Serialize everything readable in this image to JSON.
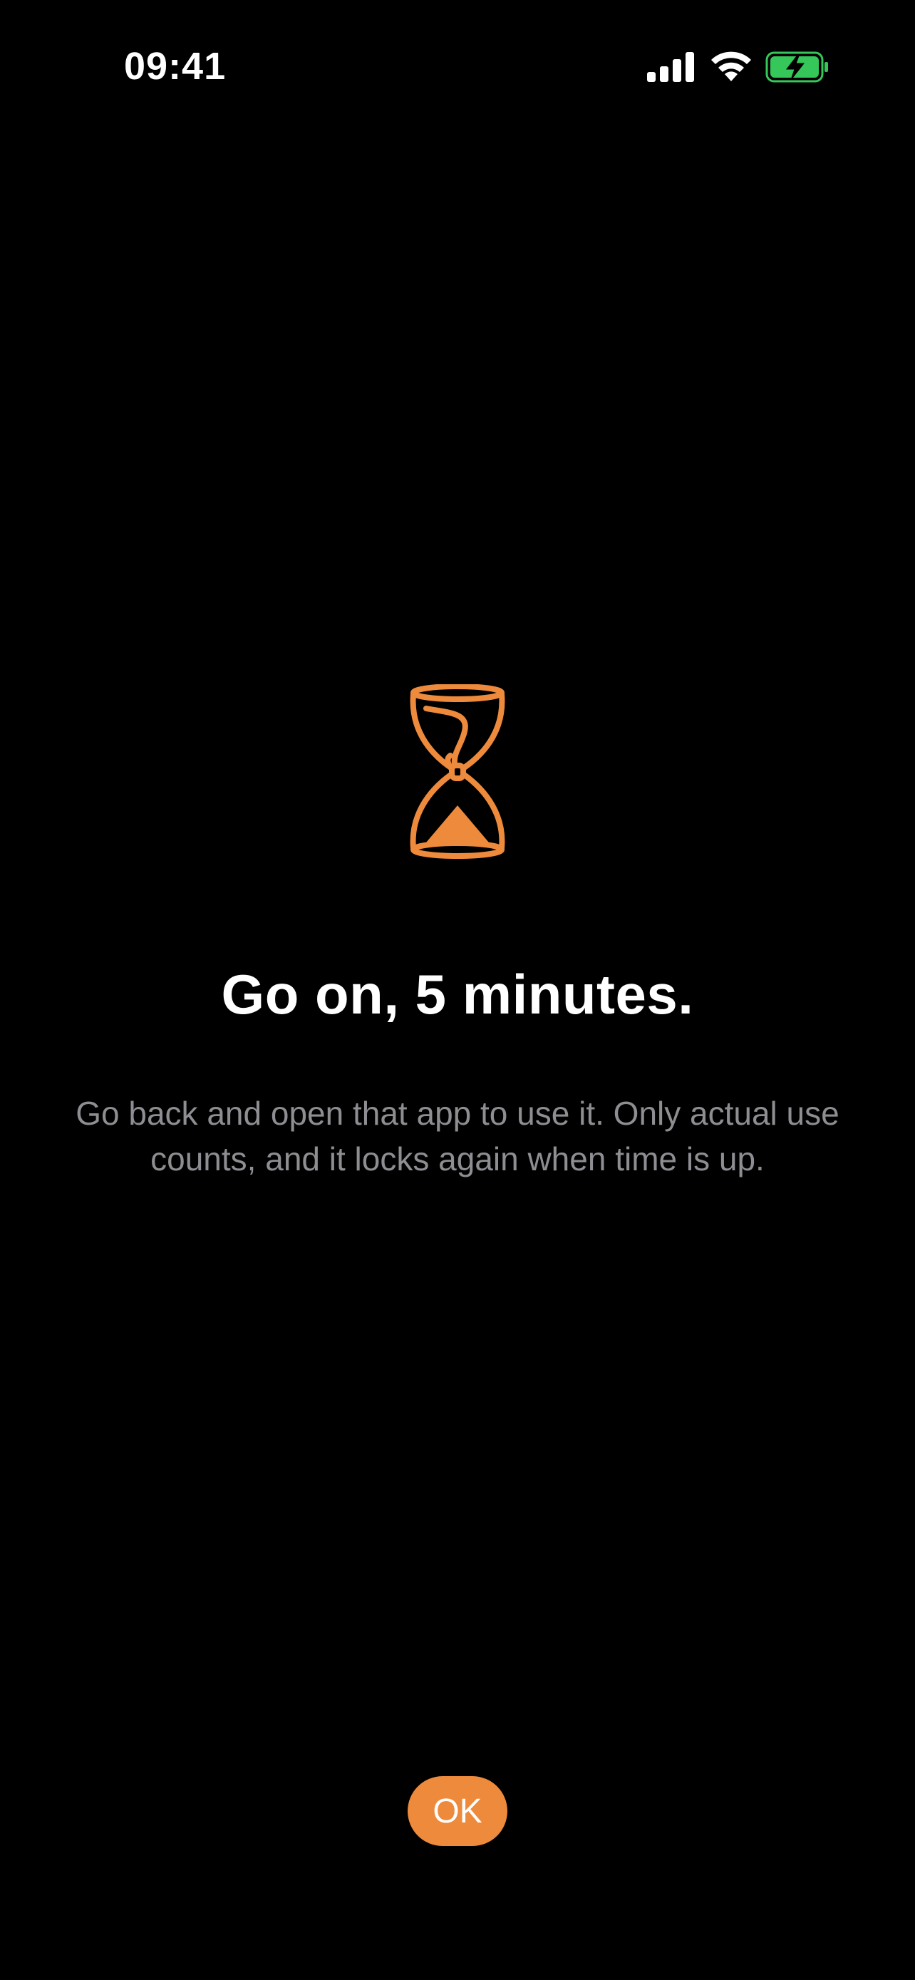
{
  "status_bar": {
    "time": "09:41",
    "icons": [
      "signal-icon",
      "wifi-icon",
      "battery-charging-icon"
    ],
    "battery_color": "#35c759"
  },
  "main": {
    "icon": "hourglass-icon",
    "accent_color": "#ee8a3c",
    "title": "Go on, 5 minutes.",
    "description": "Go back and open that app to use it. Only actual use counts, and it locks again when time is up."
  },
  "actions": {
    "ok_label": "OK"
  }
}
